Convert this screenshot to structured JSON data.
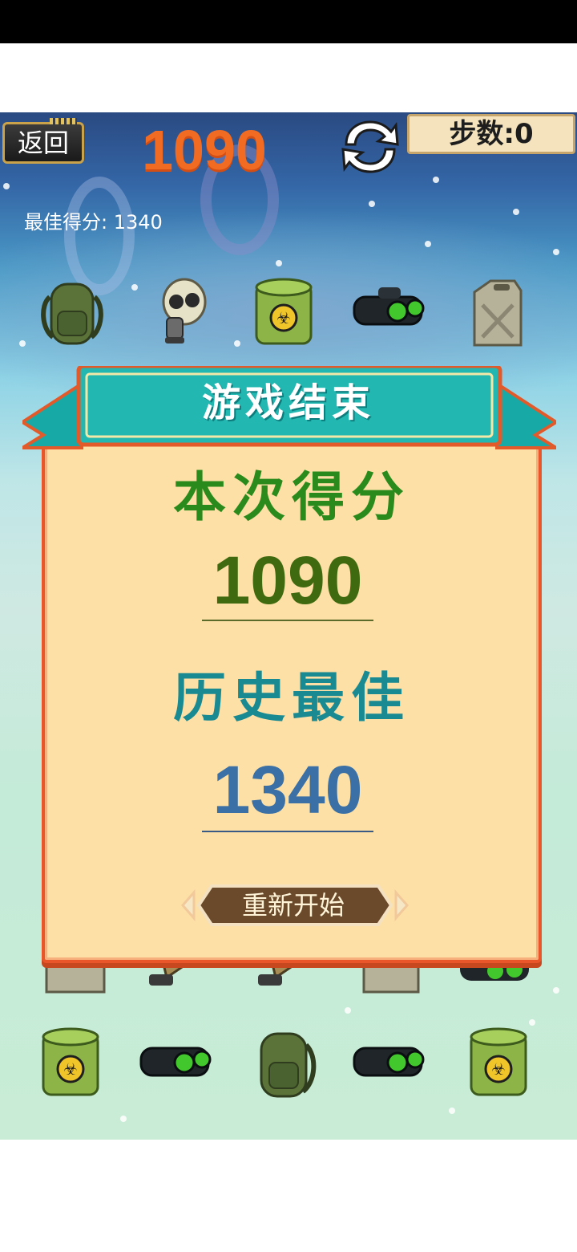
{
  "header": {
    "back_label": "返回",
    "current_score": "1090",
    "steps_text": "步数:0",
    "best_label": "最佳得分:",
    "best_value": "1340"
  },
  "game_over": {
    "title": "游戏结束",
    "current_score_label": "本次得分",
    "current_score_value": "1090",
    "best_score_label": "历史最佳",
    "best_score_value": "1340",
    "restart_label": "重新开始"
  },
  "board": {
    "top_row": [
      "backpack-icon",
      "gas-mask-icon",
      "biohazard-barrel-icon",
      "night-vision-goggles-icon",
      "jerry-can-icon"
    ],
    "partial_row": [
      "jerry-can-icon",
      "gas-mask-icon",
      "gas-mask-icon",
      "jerry-can-icon",
      "night-vision-goggles-icon"
    ],
    "bottom_row": [
      "biohazard-barrel-icon",
      "night-vision-goggles-icon",
      "backpack-icon",
      "night-vision-goggles-icon",
      "biohazard-barrel-icon"
    ]
  },
  "colors": {
    "score_orange": "#f26b22",
    "current_label_green": "#2a8b1c",
    "best_label_teal": "#1a8a92",
    "best_value_blue": "#3a70a6",
    "ribbon_teal": "#22b7b0",
    "panel_bg": "#fde0a6"
  }
}
